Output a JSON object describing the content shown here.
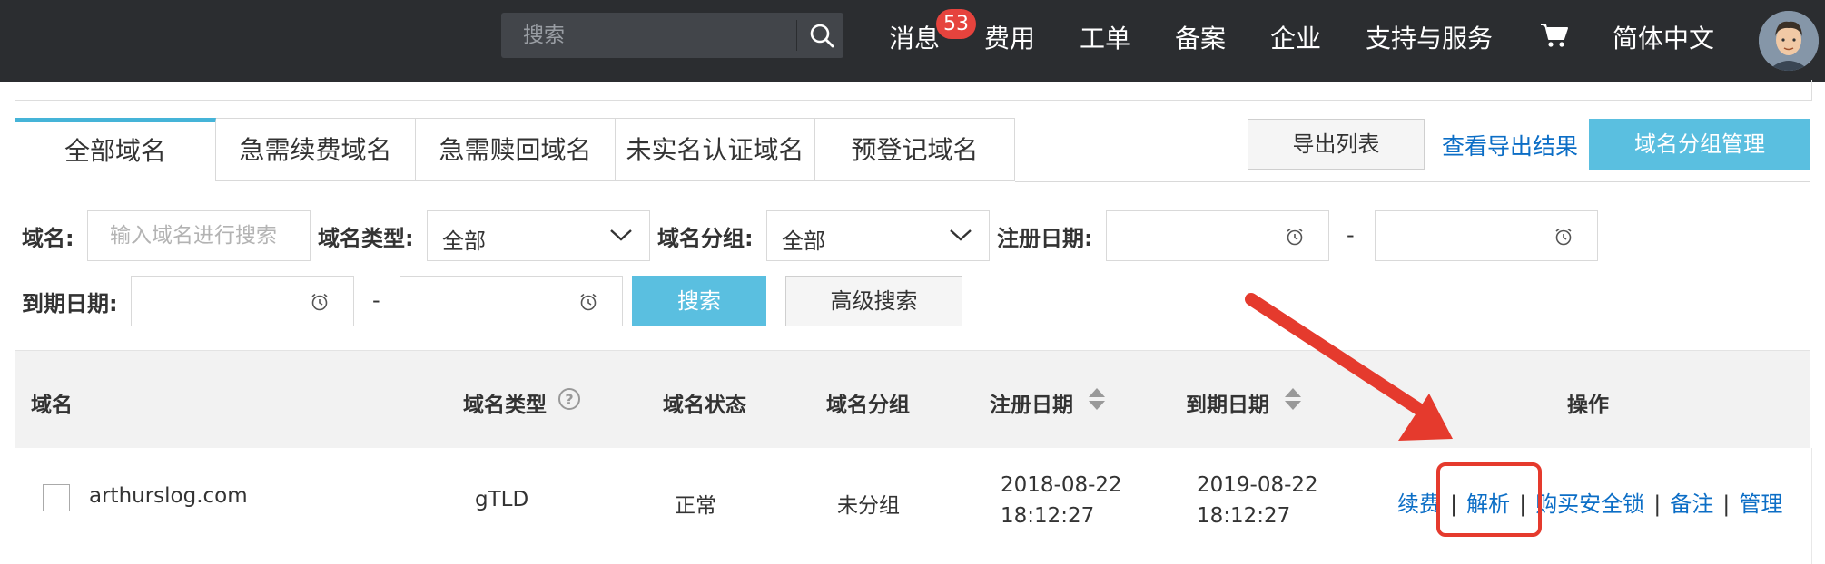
{
  "header": {
    "search_placeholder": "搜索",
    "nav": [
      "消息",
      "费用",
      "工单",
      "备案",
      "企业",
      "支持与服务",
      "简体中文"
    ],
    "message_badge": "53"
  },
  "tabs": [
    "全部域名",
    "急需续费域名",
    "急需赎回域名",
    "未实名认证域名",
    "预登记域名"
  ],
  "toolbar": {
    "export_list": "导出列表",
    "view_export": "查看导出结果",
    "group_manage": "域名分组管理"
  },
  "filters": {
    "domain_label": "域名:",
    "domain_placeholder": "输入域名进行搜索",
    "type_label": "域名类型:",
    "type_value": "全部",
    "group_label": "域名分组:",
    "group_value": "全部",
    "reg_date_label": "注册日期:",
    "expire_date_label": "到期日期:",
    "range_sep": "-",
    "search_button": "搜索",
    "advanced_button": "高级搜索"
  },
  "table": {
    "headers": {
      "domain": "域名",
      "type": "域名类型",
      "status": "域名状态",
      "group": "域名分组",
      "reg_date": "注册日期",
      "expire_date": "到期日期",
      "actions": "操作"
    },
    "rows": [
      {
        "domain": "arthurslog.com",
        "type": "gTLD",
        "status": "正常",
        "group": "未分组",
        "reg_date": "2018-08-22",
        "reg_time": "18:12:27",
        "expire_date": "2019-08-22",
        "expire_time": "18:12:27",
        "actions": [
          "续费",
          "解析",
          "购买安全锁",
          "备注",
          "管理"
        ]
      }
    ]
  },
  "annotation": {
    "color": "#e53a2d",
    "target": "解析"
  }
}
